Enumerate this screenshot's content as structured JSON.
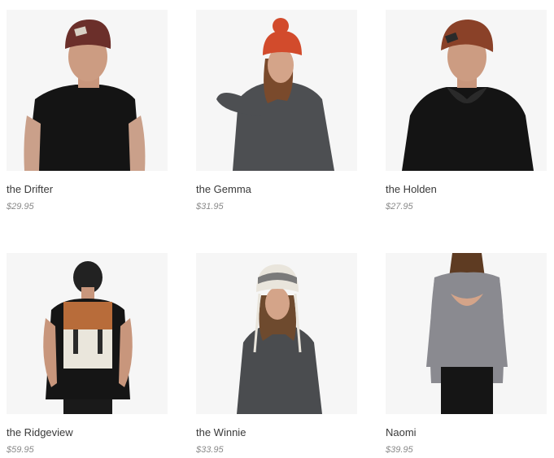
{
  "products": [
    {
      "name": "the Drifter",
      "price": "$29.95",
      "image": "man-brown-beanie-black-tee"
    },
    {
      "name": "the Gemma",
      "price": "$31.95",
      "image": "woman-orange-pom-beanie-grey-sweater"
    },
    {
      "name": "the Holden",
      "price": "$27.95",
      "image": "man-brown-beanie-black-hoodie"
    },
    {
      "name": "the Ridgeview",
      "price": "$59.95",
      "image": "man-back-backpack"
    },
    {
      "name": "the Winnie",
      "price": "$33.95",
      "image": "woman-white-pom-beanie-grey-sweater"
    },
    {
      "name": "Naomi",
      "price": "$39.95",
      "image": "woman-back-open-back-top"
    }
  ]
}
